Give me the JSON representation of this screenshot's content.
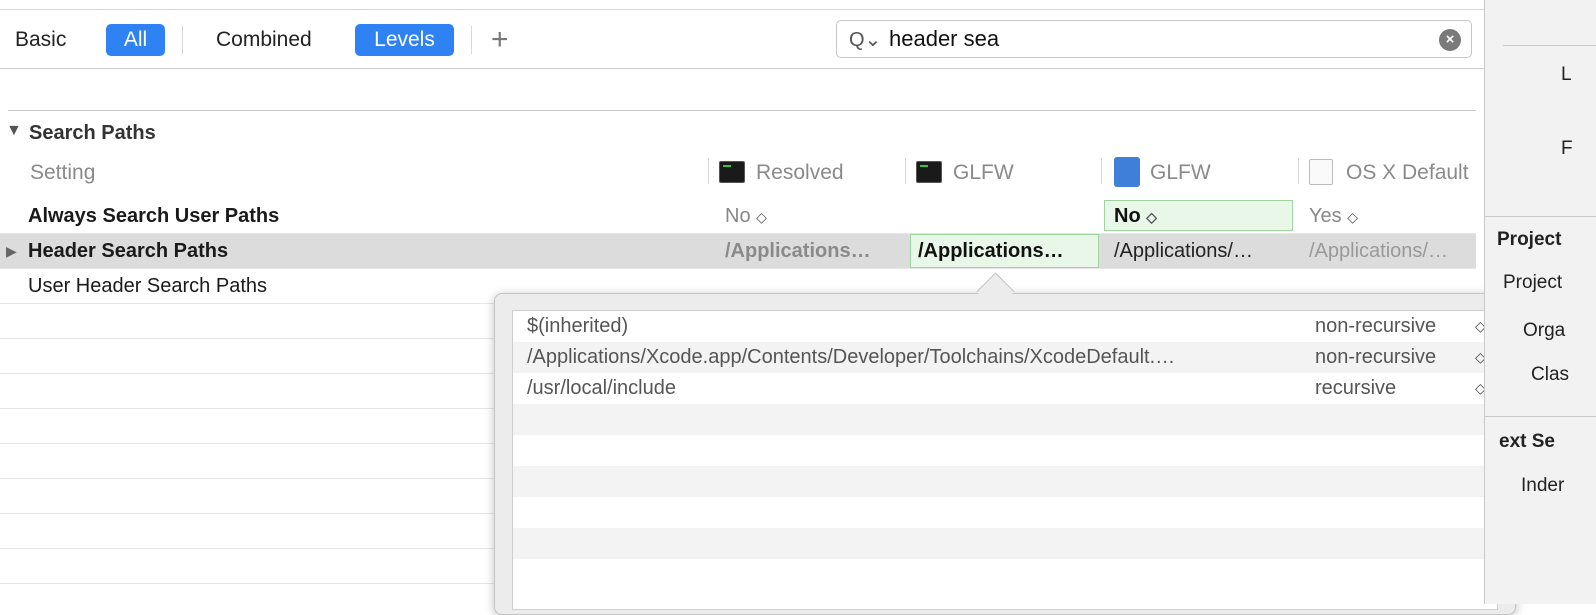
{
  "toolbar": {
    "basic": "Basic",
    "all": "All",
    "combined": "Combined",
    "levels": "Levels",
    "add": "+"
  },
  "search": {
    "value": "header sea",
    "icon": "Q⌄",
    "clear": "×"
  },
  "section": {
    "title": "Search Paths",
    "column_setting": "Setting",
    "columns": [
      "Resolved",
      "GLFW",
      "GLFW",
      "OS X Default"
    ]
  },
  "rows": [
    {
      "label": "Always Search User Paths",
      "resolved": "No",
      "glfw_target": "",
      "glfw_project": "No",
      "osx_default": "Yes"
    },
    {
      "label": "Header Search Paths",
      "resolved": "/Applications…",
      "glfw_target": "/Applications…",
      "glfw_project": "/Applications/…",
      "osx_default": "/Applications/…"
    },
    {
      "label": "User Header Search Paths"
    }
  ],
  "popover": {
    "items": [
      {
        "path": "$(inherited)",
        "mode": "non-recursive"
      },
      {
        "path": "/Applications/Xcode.app/Contents/Developer/Toolchains/XcodeDefault.…",
        "mode": "non-recursive"
      },
      {
        "path": "/usr/local/include",
        "mode": "recursive"
      }
    ]
  },
  "inspector": {
    "labels": [
      "L",
      "F",
      "Project",
      "Project",
      "Orga",
      "Clas",
      "ext Se",
      "Inder"
    ]
  },
  "colors": {
    "accent": "#2f82f3",
    "highlight_row": "#dcdcdc",
    "edit_cell": "#e9f7e9"
  }
}
